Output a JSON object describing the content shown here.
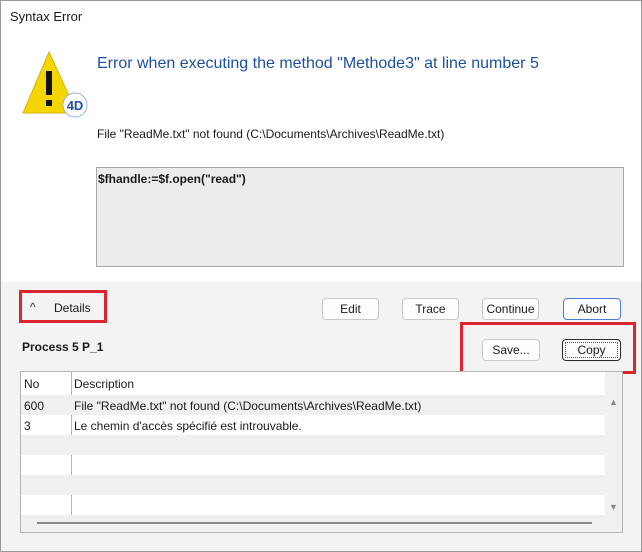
{
  "window": {
    "title": "Syntax Error"
  },
  "error": {
    "heading": "Error when executing the method \"Methode3\" at line number 5",
    "message": "File \"ReadMe.txt\" not found (C:\\Documents\\Archives\\ReadMe.txt)",
    "code": "$fhandle:=$f.open(\"read\")",
    "icon": "warning-triangle-4d-icon"
  },
  "details": {
    "toggle_label": "Details",
    "chevron": "^"
  },
  "buttons": {
    "edit": "Edit",
    "trace": "Trace",
    "continue": "Continue",
    "abort": "Abort",
    "save": "Save...",
    "copy": "Copy"
  },
  "process": {
    "label": "Process 5 P_1"
  },
  "table": {
    "columns": [
      "No",
      "Description"
    ],
    "rows": [
      {
        "no": "600",
        "description": "File \"ReadMe.txt\" not found (C:\\Documents\\Archives\\ReadMe.txt)"
      },
      {
        "no": "3",
        "description": "Le chemin d'accès spécifié est introuvable."
      }
    ]
  },
  "colors": {
    "heading": "#1f4fa0",
    "highlight": "#d9252b",
    "warning": "#f5d500"
  }
}
